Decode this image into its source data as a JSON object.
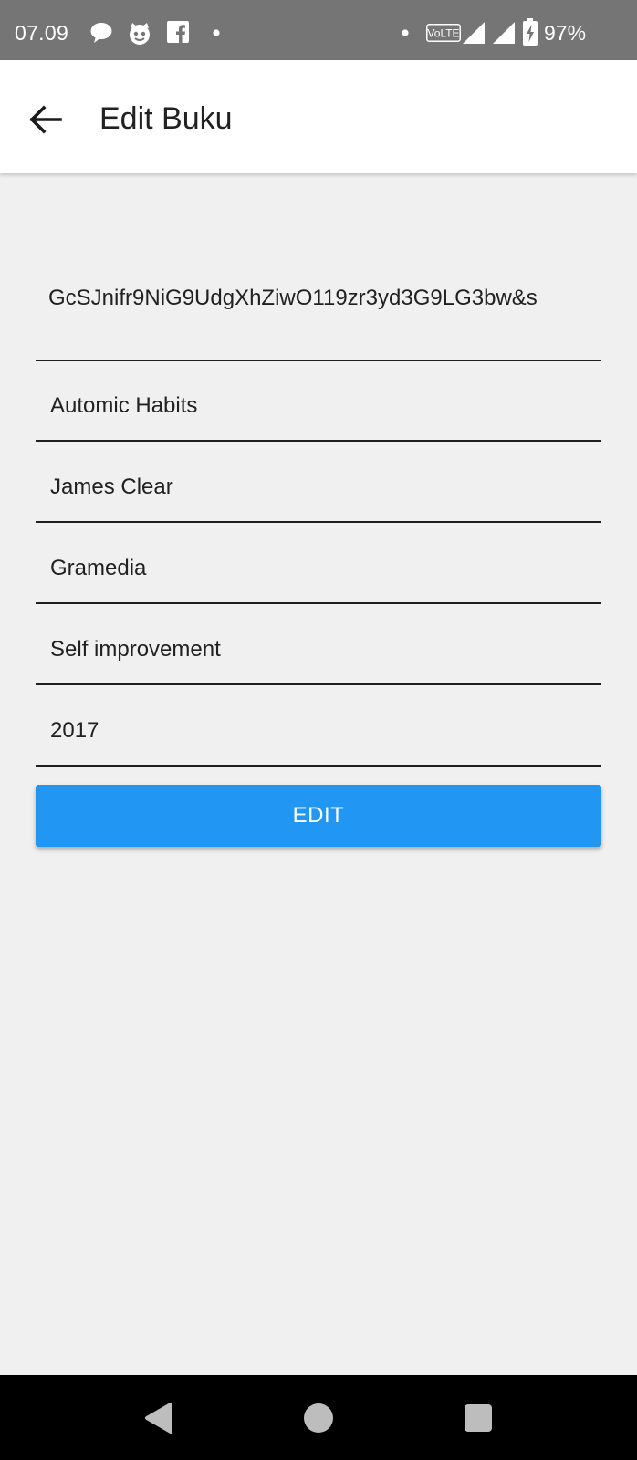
{
  "status_bar": {
    "time": "07.09",
    "battery_percent": "97%",
    "network_label": "VoLTE",
    "icons": [
      "chat-bubble-icon",
      "cat-face-icon",
      "facebook-icon",
      "notification-dot-icon",
      "volte-icon",
      "signal-icon",
      "battery-charging-icon"
    ]
  },
  "app_bar": {
    "title": "Edit Buku",
    "back_icon": "arrow-left-icon"
  },
  "form": {
    "image_url": "GcSJnifr9NiG9UdgXhZiwO119zr3yd3G9LG3bw&s",
    "title": "Automic Habits",
    "author": "James Clear",
    "publisher": "Gramedia",
    "category": "Self improvement",
    "year": "2017"
  },
  "edit_button": {
    "label": "EDIT"
  },
  "nav_bar": {
    "icons": [
      "back-triangle-icon",
      "home-circle-icon",
      "recents-square-icon"
    ]
  },
  "colors": {
    "status_bar": "#757575",
    "app_bar": "#ffffff",
    "background": "#f0f0f0",
    "accent": "#2196f3",
    "nav_bar": "#000000"
  }
}
